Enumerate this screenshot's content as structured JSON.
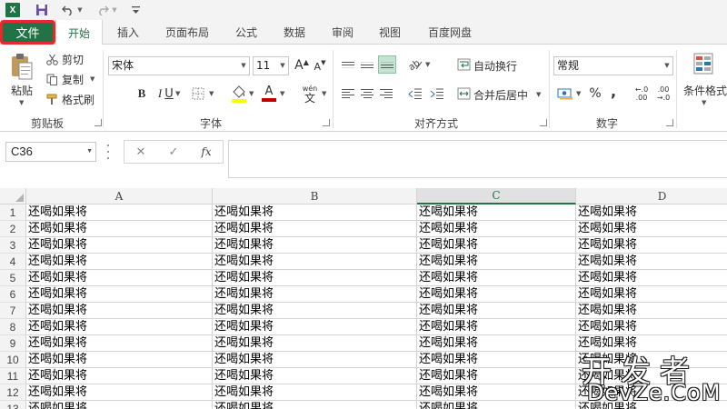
{
  "quick_access": {
    "app_icon_letter": "X",
    "icons": [
      "excel-icon",
      "save-icon",
      "undo-icon",
      "redo-icon",
      "customize-icon"
    ]
  },
  "tabs": {
    "file": "文件",
    "items": [
      "开始",
      "插入",
      "页面布局",
      "公式",
      "数据",
      "审阅",
      "视图",
      "百度网盘"
    ],
    "active_index": 0
  },
  "ribbon": {
    "clipboard": {
      "paste": "粘贴",
      "cut": "剪切",
      "copy": "复制",
      "format_painter": "格式刷",
      "label": "剪贴板"
    },
    "font": {
      "name": "宋体",
      "size": "11",
      "bold": "B",
      "italic": "I",
      "underline": "U",
      "grow": "A",
      "shrink": "A",
      "font_color_letter": "A",
      "phonetic": "wén",
      "label": "字体"
    },
    "alignment": {
      "wrap_text": "自动换行",
      "merge_center": "合并后居中",
      "label": "对齐方式"
    },
    "number": {
      "format": "常规",
      "percent": "%",
      "comma": ",",
      "inc_decimal": ".00",
      "dec_decimal": ".0",
      "label": "数字"
    },
    "styles": {
      "conditional_format": "条件格式"
    }
  },
  "formula_bar": {
    "name_box": "C36",
    "cancel": "✕",
    "enter": "✓",
    "fx": "fx",
    "value": ""
  },
  "grid": {
    "columns": [
      "A",
      "B",
      "C",
      "D"
    ],
    "selected_column": "C",
    "rows": [
      "1",
      "2",
      "3",
      "4",
      "5",
      "6",
      "7",
      "8",
      "9",
      "10",
      "11",
      "12",
      "13"
    ],
    "cell_text": "还喝如果将"
  },
  "watermark": {
    "cn": "开发者",
    "en": "DevZe.CoM"
  },
  "colors": {
    "excel_green": "#217346",
    "file_highlight_border": "#e8282b",
    "font_color_bar": "#c00000",
    "highlight_color_bar": "#ffff00"
  }
}
